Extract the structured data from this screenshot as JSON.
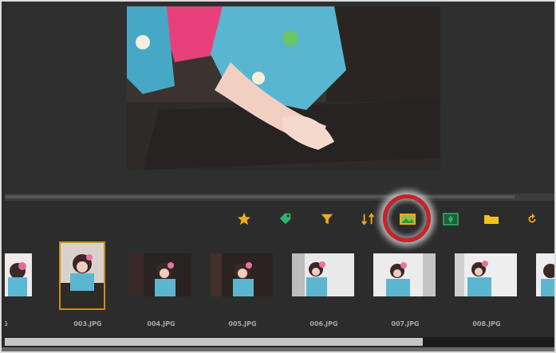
{
  "toolbar": {
    "tools": [
      {
        "name": "rating",
        "icon": "star-icon",
        "color": "#f2a91b"
      },
      {
        "name": "tag",
        "icon": "tag-icon",
        "color": "#2fb36a"
      },
      {
        "name": "filter",
        "icon": "filter-icon",
        "color": "#f2a91b"
      },
      {
        "name": "sort",
        "icon": "sort-icon",
        "color": "#f2a91b"
      },
      {
        "name": "thumbnail-view",
        "icon": "thumbnail-view-icon",
        "color": "#f2a91b",
        "highlighted": true
      },
      {
        "name": "map",
        "icon": "map-icon",
        "color": "#2fb36a"
      },
      {
        "name": "folder",
        "icon": "folder-icon",
        "color": "#f2c21b"
      },
      {
        "name": "rotate",
        "icon": "rotate-icon",
        "color": "#f2a91b"
      }
    ]
  },
  "filmstrip": {
    "items": [
      {
        "label": "JPG"
      },
      {
        "label": "003.JPG",
        "selected": true
      },
      {
        "label": "004.JPG"
      },
      {
        "label": "005.JPG"
      },
      {
        "label": "006.JPG"
      },
      {
        "label": "007.JPG"
      },
      {
        "label": "008.JPG"
      },
      {
        "label": ""
      }
    ]
  },
  "colors": {
    "accent": "#f2a91b",
    "selection_border": "#c98f1a",
    "highlight_ring": "#c8232b",
    "background": "#2b2b2b"
  }
}
